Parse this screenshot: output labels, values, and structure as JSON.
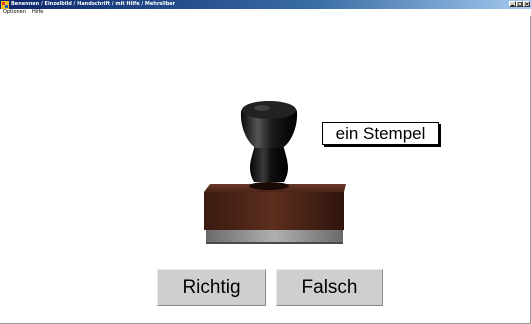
{
  "window": {
    "title": "Benennen / Einzelbild / Handschrift / mit Hilfe / Mehrsilber"
  },
  "menu": {
    "items": [
      {
        "label": "Optionen"
      },
      {
        "label": "Hilfe"
      }
    ]
  },
  "content": {
    "picture_label": "ein Stempel",
    "picture_subject": "rubber stamp"
  },
  "buttons": {
    "correct_label": "Richtig",
    "wrong_label": "Falsch"
  }
}
